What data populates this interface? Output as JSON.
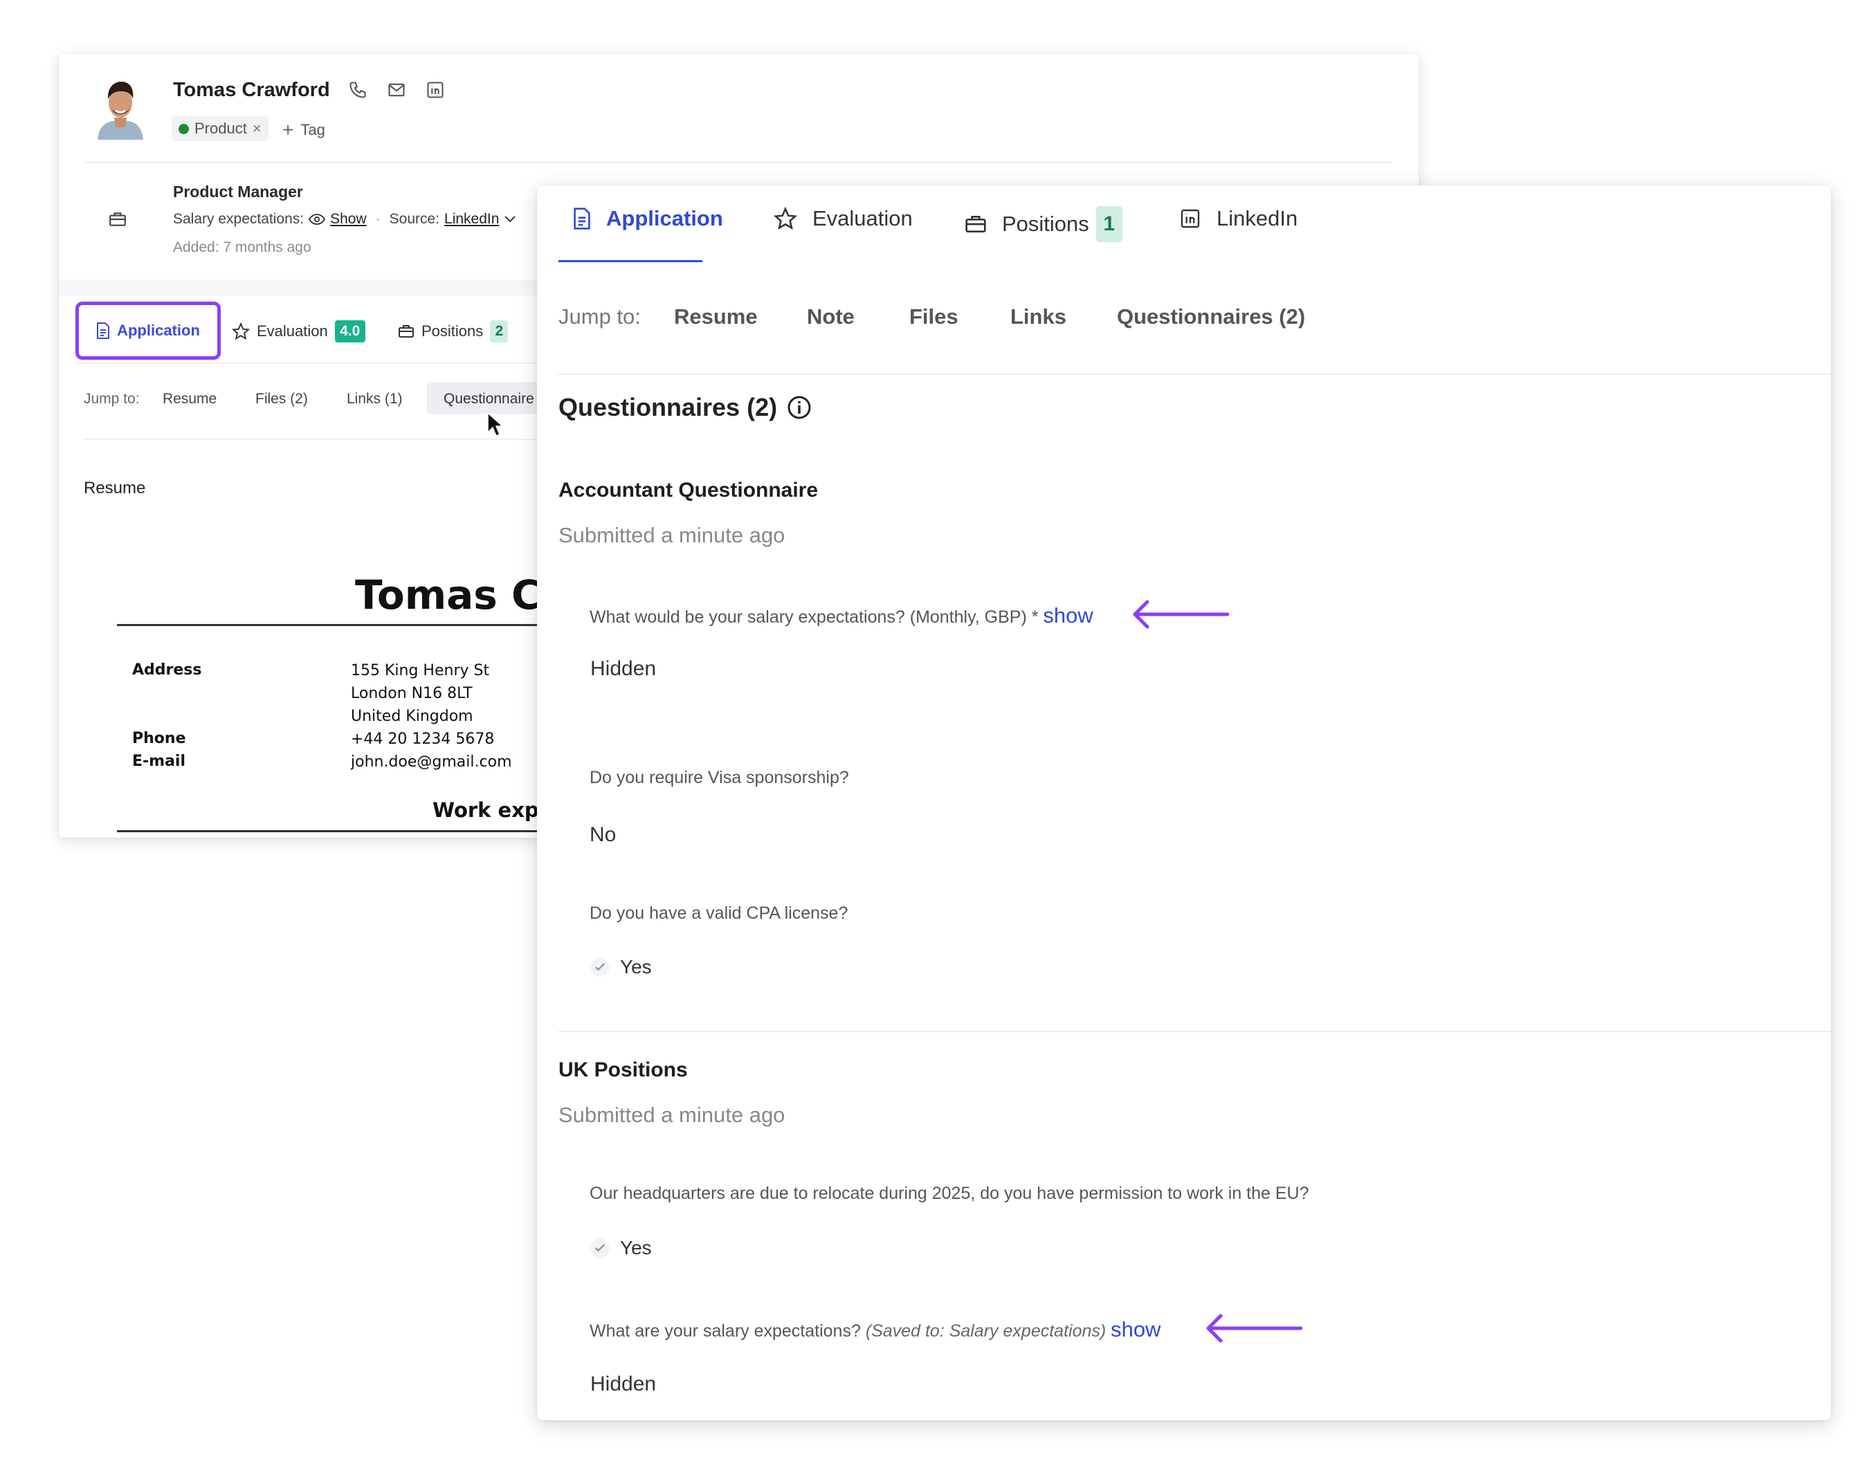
{
  "candidate": {
    "name": "Tomas Crawford",
    "tag": "Product",
    "add_tag_label": "Tag",
    "role": "Product Manager",
    "salary_label": "Salary expectations:",
    "salary_show": "Show",
    "source_label": "Source:",
    "source_value": "LinkedIn",
    "added": "Added: 7 months ago"
  },
  "back_tabs": {
    "application": "Application",
    "evaluation": "Evaluation",
    "evaluation_score": "4.0",
    "positions": "Positions",
    "positions_count": "2"
  },
  "back_jump": {
    "label": "Jump to:",
    "items": [
      "Resume",
      "Files (2)",
      "Links (1)",
      "Questionnaire"
    ]
  },
  "resume": {
    "heading": "Resume",
    "cv_name": "Tomas Cr",
    "address_label": "Address",
    "address_lines": [
      "155 King Henry St",
      "London N16 8LT",
      "United Kingdom"
    ],
    "phone_label": "Phone",
    "phone": "+44 20 1234 5678",
    "email_label": "E-mail",
    "email": "john.doe@gmail.com",
    "work_heading": "Work expe"
  },
  "front_tabs": {
    "application": "Application",
    "evaluation": "Evaluation",
    "positions": "Positions",
    "positions_count": "1",
    "linkedin": "LinkedIn"
  },
  "front_jump": {
    "label": "Jump to:",
    "items": [
      "Resume",
      "Note",
      "Files",
      "Links",
      "Questionnaires (2)"
    ]
  },
  "questionnaires": {
    "title": "Questionnaires (2)",
    "accountant": {
      "title": "Accountant Questionnaire",
      "submitted": "Submitted a minute ago",
      "q1": "What would be your salary expectations? (Monthly, GBP) *",
      "q1_show": "show",
      "a1": "Hidden",
      "q2": "Do you require Visa sponsorship?",
      "a2": "No",
      "q3": "Do you have a valid CPA license?",
      "a3": "Yes"
    },
    "uk": {
      "title": "UK Positions",
      "submitted": "Submitted a minute ago",
      "q1": "Our headquarters are due to relocate during 2025, do you have permission to work in the EU?",
      "a1": "Yes",
      "q2": "What are your salary expectations?",
      "q2_note": "(Saved to: Salary expectations)",
      "q2_show": "show",
      "a2": "Hidden"
    }
  },
  "colors": {
    "accent": "#2f48d6",
    "highlight": "#8a3ffc",
    "evaluation_badge": "#19b28a",
    "positions_badge": "#cfeee0"
  }
}
